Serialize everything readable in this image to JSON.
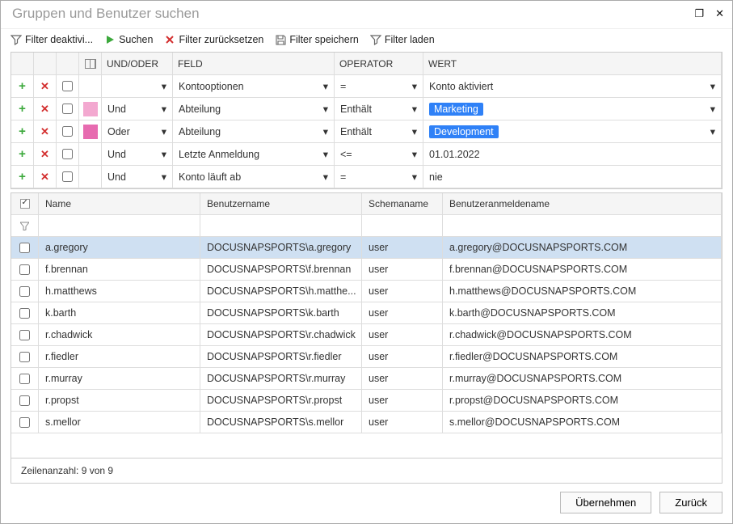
{
  "title": "Gruppen und Benutzer suchen",
  "toolbar": {
    "deactivate": "Filter deaktivi...",
    "search": "Suchen",
    "reset": "Filter zurücksetzen",
    "save": "Filter speichern",
    "load": "Filter laden"
  },
  "filter_headers": {
    "logic": "UND/ODER",
    "field": "FELD",
    "operator": "OPERATOR",
    "value": "WERT"
  },
  "filters": [
    {
      "indent": "",
      "logic": "",
      "field": "Kontooptionen",
      "operator": "=",
      "value": "Konto aktiviert",
      "pill": false,
      "valueDropdown": true
    },
    {
      "indent": "light",
      "logic": "Und",
      "field": "Abteilung",
      "operator": "Enthält",
      "value": "Marketing",
      "pill": true,
      "valueDropdown": true
    },
    {
      "indent": "dark",
      "logic": "Oder",
      "field": "Abteilung",
      "operator": "Enthält",
      "value": "Development",
      "pill": true,
      "valueDropdown": true
    },
    {
      "indent": "",
      "logic": "Und",
      "field": "Letzte Anmeldung",
      "operator": "<=",
      "value": "01.01.2022",
      "pill": false,
      "valueDropdown": false
    },
    {
      "indent": "",
      "logic": "Und",
      "field": "Konto läuft ab",
      "operator": "=",
      "value": "nie",
      "pill": false,
      "valueDropdown": false
    }
  ],
  "result_headers": {
    "name": "Name",
    "username": "Benutzername",
    "schema": "Schemaname",
    "logon": "Benutzeranmeldename"
  },
  "rows": [
    {
      "name": "a.gregory",
      "username": "DOCUSNAPSPORTS\\a.gregory",
      "schema": "user",
      "logon": "a.gregory@DOCUSNAPSPORTS.COM",
      "selected": true
    },
    {
      "name": "f.brennan",
      "username": "DOCUSNAPSPORTS\\f.brennan",
      "schema": "user",
      "logon": "f.brennan@DOCUSNAPSPORTS.COM"
    },
    {
      "name": "h.matthews",
      "username": "DOCUSNAPSPORTS\\h.matthe...",
      "schema": "user",
      "logon": "h.matthews@DOCUSNAPSPORTS.COM"
    },
    {
      "name": "k.barth",
      "username": "DOCUSNAPSPORTS\\k.barth",
      "schema": "user",
      "logon": "k.barth@DOCUSNAPSPORTS.COM"
    },
    {
      "name": "r.chadwick",
      "username": "DOCUSNAPSPORTS\\r.chadwick",
      "schema": "user",
      "logon": "r.chadwick@DOCUSNAPSPORTS.COM"
    },
    {
      "name": "r.fiedler",
      "username": "DOCUSNAPSPORTS\\r.fiedler",
      "schema": "user",
      "logon": "r.fiedler@DOCUSNAPSPORTS.COM"
    },
    {
      "name": "r.murray",
      "username": "DOCUSNAPSPORTS\\r.murray",
      "schema": "user",
      "logon": "r.murray@DOCUSNAPSPORTS.COM"
    },
    {
      "name": "r.propst",
      "username": "DOCUSNAPSPORTS\\r.propst",
      "schema": "user",
      "logon": "r.propst@DOCUSNAPSPORTS.COM"
    },
    {
      "name": "s.mellor",
      "username": "DOCUSNAPSPORTS\\s.mellor",
      "schema": "user",
      "logon": "s.mellor@DOCUSNAPSPORTS.COM"
    }
  ],
  "rowcount": "Zeilenanzahl: 9 von 9",
  "buttons": {
    "apply": "Übernehmen",
    "back": "Zurück"
  },
  "glyphs": {
    "add": "+",
    "del": "✕",
    "arrow": "▾",
    "max": "❐",
    "close": "✕",
    "check": "✓",
    "filter": "▽"
  }
}
